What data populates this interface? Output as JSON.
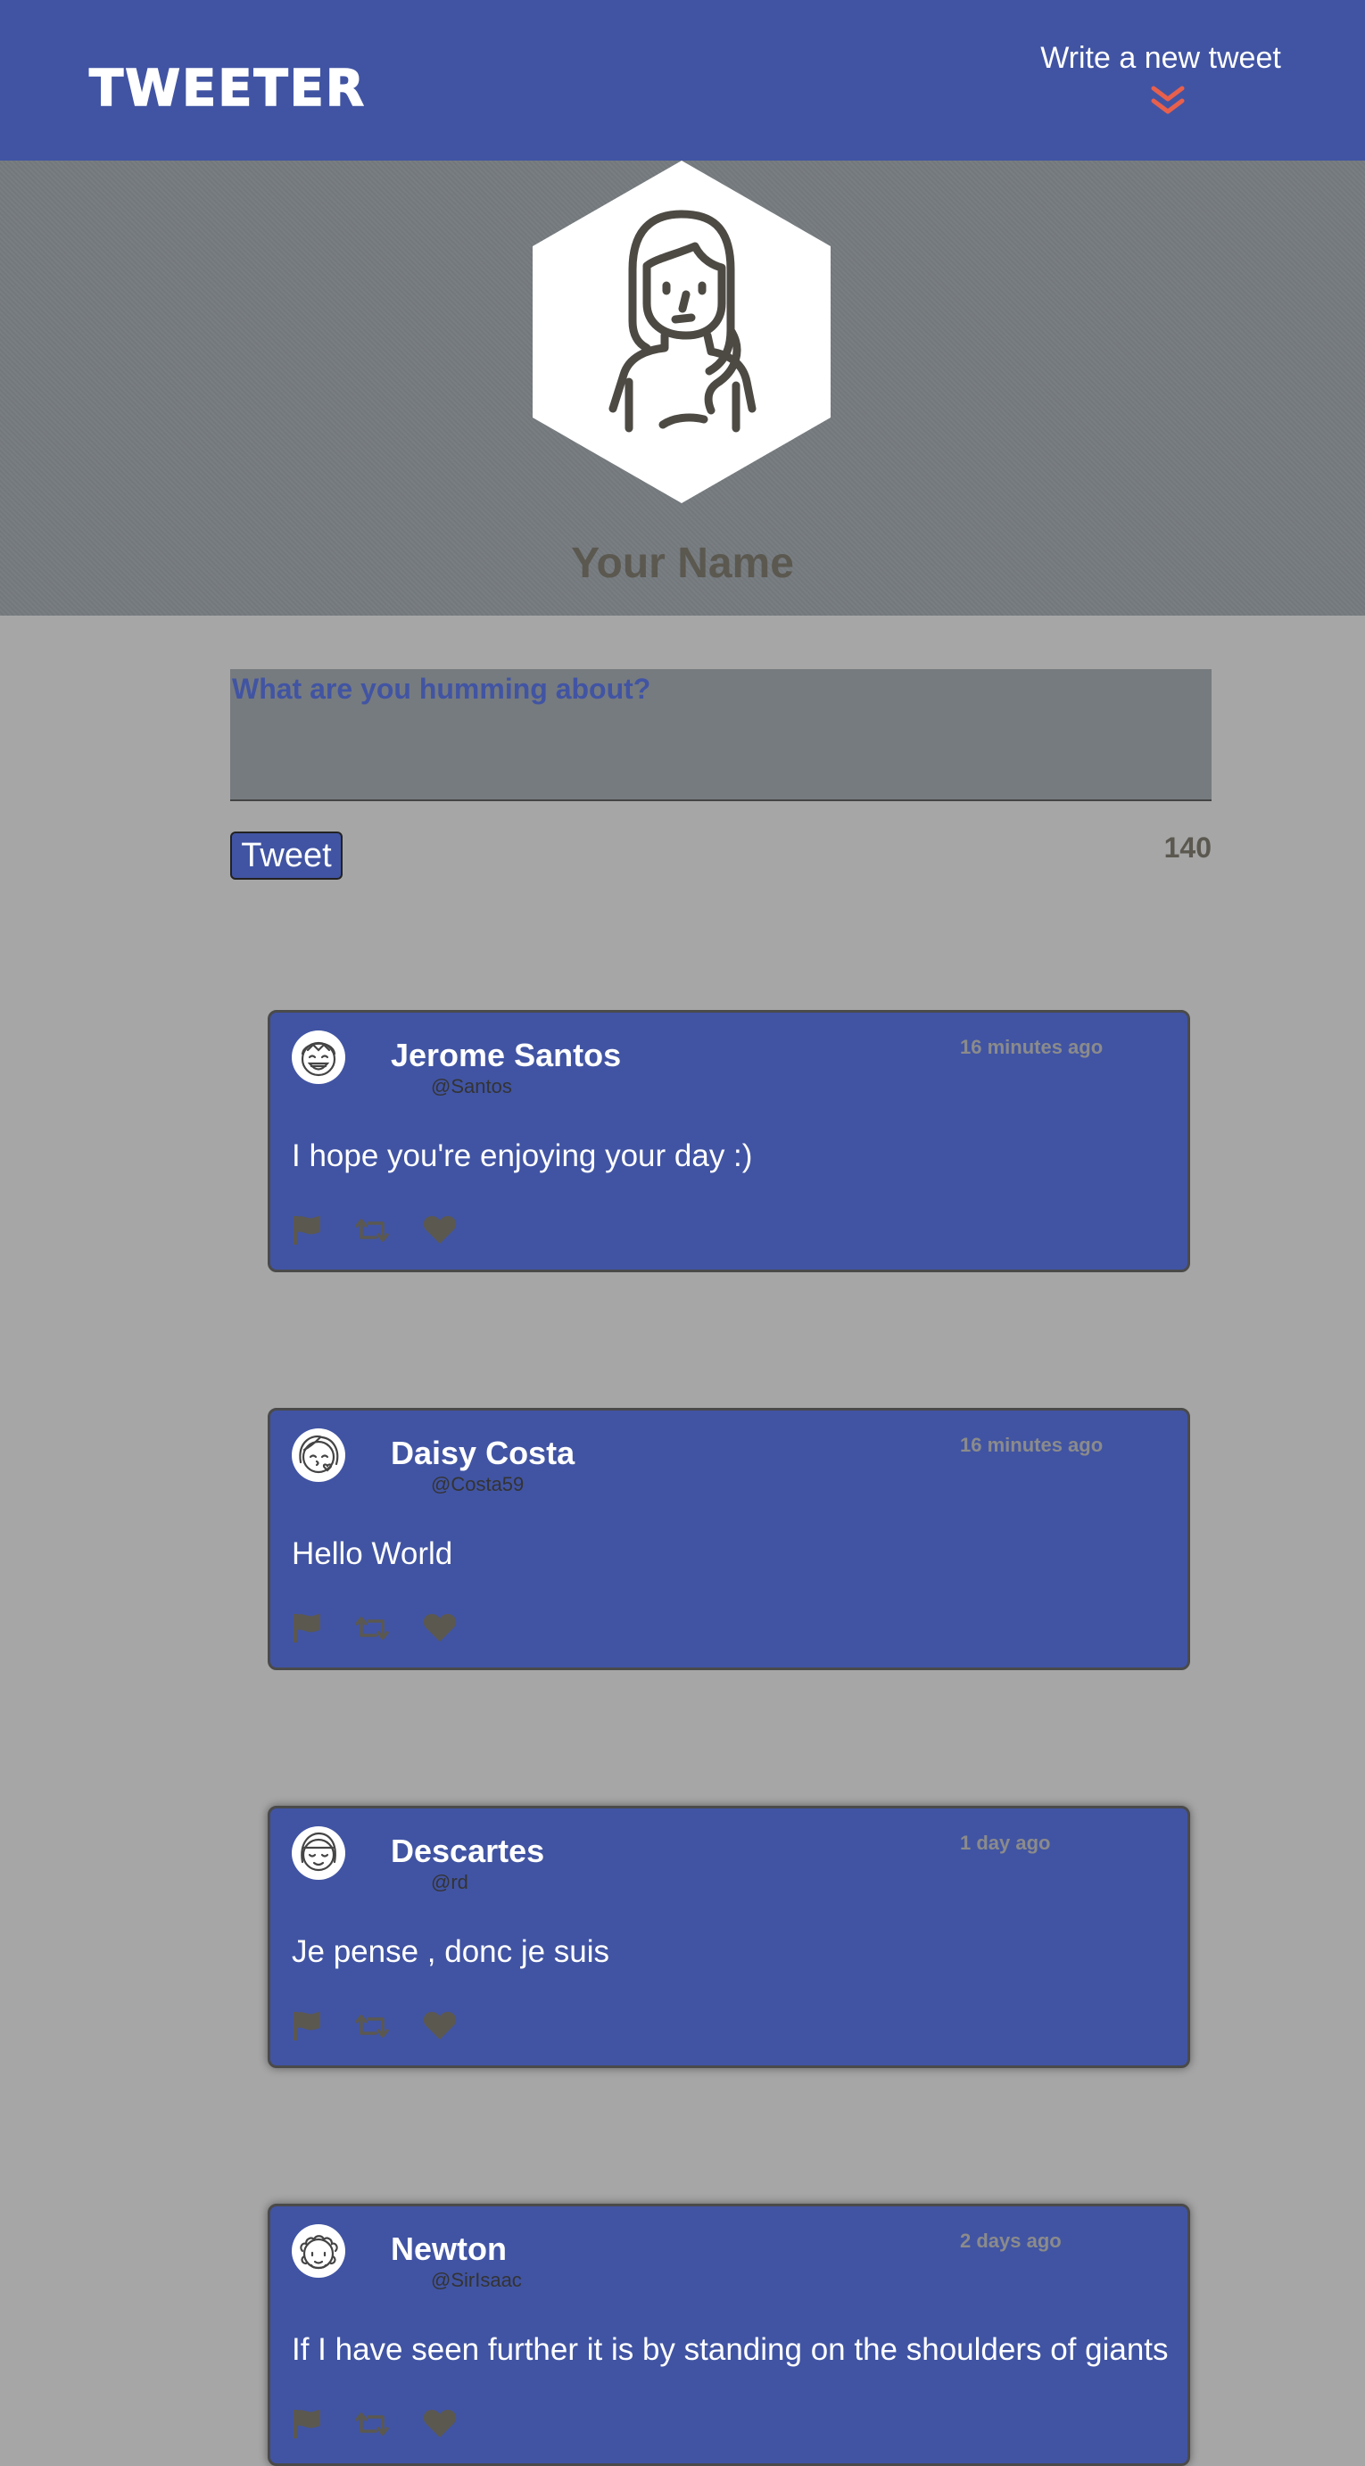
{
  "nav": {
    "logo": "TWEETER",
    "write_link": "Write a new tweet",
    "chevron_color": "#e8604c"
  },
  "profile": {
    "name": "Your Name",
    "avatar_icon": "woman-avatar-icon"
  },
  "composer": {
    "placeholder": "What are you humming about?",
    "button_label": "Tweet",
    "counter": "140"
  },
  "colors": {
    "brand": "#4154a3",
    "background": "#a6a6a6",
    "profile_bg": "#767b7f",
    "accent": "#e8604c"
  },
  "tweets": [
    {
      "name": "Jerome Santos",
      "handle": "@Santos",
      "time": "16 minutes ago",
      "text": "I hope you're enjoying your day :)",
      "avatar_icon": "laughing-boy-avatar-icon"
    },
    {
      "name": "Daisy Costa",
      "handle": "@Costa59",
      "time": "16 minutes ago",
      "text": "Hello World",
      "avatar_icon": "kissing-girl-avatar-icon"
    },
    {
      "name": "Descartes",
      "handle": "@rd",
      "time": "1 day ago",
      "text": "Je pense , donc je suis",
      "avatar_icon": "smiling-girl-avatar-icon"
    },
    {
      "name": "Newton",
      "handle": "@SirIsaac",
      "time": "2 days ago",
      "text": "If I have seen further it is by standing on the shoulders of giants",
      "avatar_icon": "curly-hair-avatar-icon"
    }
  ],
  "actions": {
    "icons": [
      "flag-icon",
      "retweet-icon",
      "heart-icon"
    ]
  }
}
